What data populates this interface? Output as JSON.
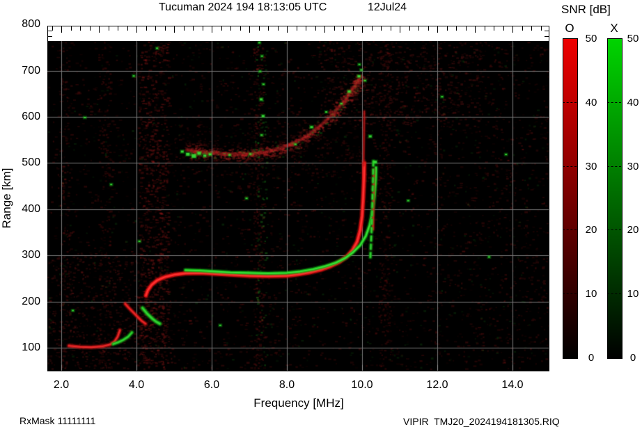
{
  "header": {
    "title": "Tucuman 2024 194 18:13:05 UTC",
    "date": "12Jul24"
  },
  "footer": {
    "rx_mask": "RxMask 11111111",
    "file": "VIPIR  TMJ20_2024194181305.RIQ"
  },
  "chart_data": {
    "type": "heatmap",
    "subtype": "ionogram",
    "title": "Tucuman 2024 194 18:13:05 UTC",
    "date_label": "12Jul24",
    "station": "Tucuman",
    "grid": true,
    "grid_color": "#787878",
    "background_color": "#000000",
    "x_axis": {
      "label": "Frequency [MHz]",
      "ticks": [
        2.0,
        4.0,
        6.0,
        8.0,
        10.0,
        12.0,
        14.0
      ],
      "tick_labels": [
        "2.0",
        "4.0",
        "6.0",
        "8.0",
        "10.0",
        "12.0",
        "14.0"
      ],
      "range": [
        1.63,
        14.96
      ],
      "minor_tick_step": 0.25
    },
    "y_axis": {
      "label": "Range [km]",
      "ticks": [
        100,
        200,
        300,
        400,
        500,
        600,
        700,
        800
      ],
      "tick_labels": [
        "100",
        "200",
        "300",
        "400",
        "500",
        "600",
        "700",
        "800"
      ],
      "range": [
        52,
        800
      ],
      "minor_tick_step": 12.5
    },
    "colorbar": {
      "title": "SNR [dB]",
      "range": [
        0,
        50
      ],
      "ticks": [
        50,
        40,
        30,
        20,
        10,
        0
      ],
      "modes": [
        {
          "label": "O",
          "color": "#ee0000"
        },
        {
          "label": "X",
          "color": "#00d400"
        }
      ]
    },
    "traces": [
      {
        "name": "E-layer O-mode",
        "mode": "O",
        "color": "#c01010",
        "core": "#f03030",
        "width": 4.5,
        "alpha": 0.8,
        "points": [
          [
            2.2,
            104
          ],
          [
            2.5,
            102
          ],
          [
            2.8,
            101
          ],
          [
            3.1,
            103
          ],
          [
            3.3,
            107
          ],
          [
            3.42,
            114
          ],
          [
            3.5,
            124
          ],
          [
            3.56,
            138
          ]
        ]
      },
      {
        "name": "E-layer X-mode",
        "mode": "X",
        "color": "#18a818",
        "core": "#35d535",
        "width": 4.5,
        "alpha": 0.85,
        "points": [
          [
            3.38,
            108
          ],
          [
            3.52,
            112
          ],
          [
            3.65,
            117
          ],
          [
            3.78,
            124
          ],
          [
            3.88,
            133
          ]
        ]
      },
      {
        "name": "F-cusp O-mode",
        "mode": "O",
        "color": "#c01010",
        "core": "#ee2828",
        "width": 4.5,
        "alpha": 0.85,
        "points": [
          [
            3.7,
            195
          ],
          [
            3.8,
            186
          ],
          [
            3.92,
            176
          ],
          [
            4.04,
            166
          ],
          [
            4.14,
            158
          ],
          [
            4.24,
            152
          ]
        ]
      },
      {
        "name": "F-cusp X-mode",
        "mode": "X",
        "color": "#18a818",
        "core": "#35d535",
        "width": 5,
        "alpha": 0.9,
        "points": [
          [
            4.16,
            186
          ],
          [
            4.28,
            174
          ],
          [
            4.42,
            163
          ],
          [
            4.53,
            156
          ],
          [
            4.62,
            152
          ]
        ]
      },
      {
        "name": "F-layer O-mode",
        "mode": "O",
        "color": "#d81010",
        "core": "#ff3030",
        "width": 5.5,
        "alpha": 0.92,
        "points": [
          [
            4.25,
            213
          ],
          [
            4.3,
            224
          ],
          [
            4.4,
            236
          ],
          [
            4.55,
            246
          ],
          [
            4.75,
            253
          ],
          [
            5.0,
            258
          ],
          [
            5.3,
            261
          ],
          [
            5.7,
            262
          ],
          [
            6.1,
            260
          ],
          [
            6.5,
            258
          ],
          [
            7.0,
            256
          ],
          [
            7.5,
            255
          ],
          [
            8.0,
            256
          ],
          [
            8.3,
            259
          ],
          [
            8.6,
            263
          ],
          [
            8.9,
            269
          ],
          [
            9.15,
            276
          ],
          [
            9.4,
            286
          ],
          [
            9.6,
            298
          ],
          [
            9.75,
            312
          ],
          [
            9.87,
            330
          ],
          [
            9.95,
            355
          ],
          [
            10.0,
            385
          ],
          [
            10.03,
            425
          ],
          [
            10.05,
            465
          ],
          [
            10.06,
            500
          ]
        ]
      },
      {
        "name": "F-layer X-mode",
        "mode": "X",
        "color": "#16b916",
        "core": "#3ae03a",
        "width": 4.2,
        "alpha": 0.9,
        "points": [
          [
            5.3,
            268
          ],
          [
            5.7,
            267
          ],
          [
            6.1,
            265
          ],
          [
            6.5,
            263
          ],
          [
            7.0,
            262
          ],
          [
            7.5,
            261
          ],
          [
            8.0,
            262
          ],
          [
            8.35,
            265
          ],
          [
            8.7,
            270
          ],
          [
            9.0,
            276
          ],
          [
            9.3,
            284
          ],
          [
            9.55,
            294
          ],
          [
            9.75,
            306
          ],
          [
            9.95,
            322
          ],
          [
            10.1,
            342
          ],
          [
            10.2,
            365
          ],
          [
            10.28,
            395
          ],
          [
            10.33,
            430
          ],
          [
            10.36,
            465
          ],
          [
            10.37,
            490
          ]
        ]
      },
      {
        "name": "O-mode asymptote fade",
        "mode": "O",
        "color": "#b80e0e",
        "core": "#d42020",
        "width": 3.2,
        "alpha": 0.5,
        "points": [
          [
            10.04,
            495
          ],
          [
            10.05,
            550
          ],
          [
            10.06,
            612
          ]
        ]
      },
      {
        "name": "second asymptote streak",
        "mode": "O",
        "color": "#c51010",
        "core": "#e62424",
        "width": 3.6,
        "alpha": 0.75,
        "points": [
          [
            10.29,
            356
          ],
          [
            10.3,
            420
          ],
          [
            10.31,
            486
          ]
        ]
      },
      {
        "name": "X-mode asymptote dashes",
        "mode": "X",
        "color": "#18a818",
        "core": "#35d535",
        "width": 4,
        "alpha": 0.85,
        "dash": [
          6,
          6
        ],
        "points": [
          [
            10.22,
            296
          ],
          [
            10.25,
            350
          ],
          [
            10.27,
            405
          ],
          [
            10.29,
            458
          ],
          [
            10.3,
            506
          ]
        ]
      }
    ],
    "diffuse_traces": [
      {
        "name": "spread-F second echo",
        "color": [
          190,
          35,
          35
        ],
        "spread": 11,
        "count": 950,
        "green_fraction": 0.08,
        "points": [
          [
            5.35,
            528
          ],
          [
            5.7,
            524
          ],
          [
            6.1,
            521
          ],
          [
            6.5,
            519
          ],
          [
            6.9,
            519
          ],
          [
            7.2,
            521
          ],
          [
            7.55,
            526
          ],
          [
            7.9,
            534
          ],
          [
            8.25,
            545
          ],
          [
            8.6,
            562
          ],
          [
            8.95,
            585
          ],
          [
            9.25,
            608
          ],
          [
            9.5,
            632
          ],
          [
            9.7,
            655
          ],
          [
            9.85,
            672
          ],
          [
            9.95,
            685
          ]
        ]
      }
    ],
    "green_specks": [
      [
        5.18,
        527,
        4
      ],
      [
        5.32,
        522,
        5
      ],
      [
        5.47,
        519,
        6
      ],
      [
        5.62,
        524,
        5
      ],
      [
        5.78,
        518,
        4
      ],
      [
        5.92,
        521,
        4
      ],
      [
        6.45,
        519,
        3
      ],
      [
        7.0,
        521,
        3
      ],
      [
        7.28,
        640,
        4
      ],
      [
        7.33,
        604,
        4
      ],
      [
        7.3,
        562,
        3
      ],
      [
        7.26,
        700,
        3
      ],
      [
        7.31,
        733,
        3
      ],
      [
        7.24,
        762,
        3
      ],
      [
        7.35,
        672,
        3
      ],
      [
        8.2,
        542,
        3
      ],
      [
        8.62,
        580,
        4
      ],
      [
        9.02,
        612,
        3
      ],
      [
        9.42,
        630,
        3
      ],
      [
        9.62,
        657,
        4
      ],
      [
        9.88,
        690,
        4
      ],
      [
        9.95,
        703,
        3
      ],
      [
        10.18,
        560,
        4
      ],
      [
        10.3,
        505,
        5
      ],
      [
        9.9,
        715,
        3
      ],
      [
        10.05,
        680,
        3
      ],
      [
        4.52,
        750,
        3
      ],
      [
        6.9,
        425,
        3
      ],
      [
        2.28,
        182,
        3
      ],
      [
        4.05,
        332,
        3
      ],
      [
        12.1,
        645,
        3
      ],
      [
        13.35,
        298,
        3
      ],
      [
        3.3,
        455,
        3
      ],
      [
        6.2,
        150,
        3
      ],
      [
        11.2,
        420,
        3
      ],
      [
        13.8,
        520,
        3
      ],
      [
        2.6,
        600,
        3
      ],
      [
        3.9,
        690,
        3
      ]
    ],
    "noise_regions": [
      {
        "f": [
          1.63,
          14.96
        ],
        "r": [
          55,
          790
        ],
        "count": 3000,
        "color": [
          148,
          24,
          24
        ],
        "alpha": [
          0.05,
          0.28
        ],
        "size": [
          2,
          5
        ]
      },
      {
        "f": [
          1.63,
          14.96
        ],
        "r": [
          55,
          790
        ],
        "count": 550,
        "color": [
          28,
          135,
          28
        ],
        "alpha": [
          0.05,
          0.22
        ],
        "size": [
          2,
          4
        ]
      },
      {
        "f": [
          4.05,
          4.85
        ],
        "r": [
          55,
          780
        ],
        "count": 800,
        "color": [
          158,
          26,
          26
        ],
        "alpha": [
          0.08,
          0.38
        ],
        "size": [
          2,
          5
        ]
      },
      {
        "f": [
          7.1,
          7.38
        ],
        "r": [
          55,
          780
        ],
        "count": 280,
        "color": [
          150,
          25,
          25
        ],
        "alpha": [
          0.08,
          0.32
        ],
        "size": [
          2,
          4
        ]
      },
      {
        "f": [
          2.98,
          3.3
        ],
        "r": [
          55,
          780
        ],
        "count": 200,
        "color": [
          140,
          20,
          20
        ],
        "alpha": [
          0.07,
          0.28
        ],
        "size": [
          2,
          4
        ]
      },
      {
        "f": [
          10.42,
          10.78
        ],
        "r": [
          55,
          780
        ],
        "count": 240,
        "color": [
          140,
          20,
          20
        ],
        "alpha": [
          0.07,
          0.3
        ],
        "size": [
          2,
          4
        ]
      },
      {
        "f": [
          1.95,
          2.2
        ],
        "r": [
          55,
          780
        ],
        "count": 150,
        "color": [
          150,
          25,
          25
        ],
        "alpha": [
          0.08,
          0.28
        ],
        "size": [
          2,
          4
        ]
      },
      {
        "f": [
          8.8,
          13.2
        ],
        "r": [
          580,
          770
        ],
        "count": 560,
        "color": [
          150,
          30,
          30
        ],
        "alpha": [
          0.07,
          0.32
        ],
        "size": [
          2,
          5
        ]
      },
      {
        "f": [
          1.63,
          5.0
        ],
        "r": [
          55,
          310
        ],
        "count": 550,
        "color": [
          150,
          30,
          30
        ],
        "alpha": [
          0.07,
          0.3
        ],
        "size": [
          2,
          4
        ]
      },
      {
        "f": [
          5.0,
          10.0
        ],
        "r": [
          470,
          585
        ],
        "count": 260,
        "color": [
          150,
          28,
          28
        ],
        "alpha": [
          0.05,
          0.22
        ],
        "size": [
          2,
          4
        ]
      },
      {
        "f": [
          13.0,
          14.96
        ],
        "r": [
          55,
          780
        ],
        "count": 260,
        "color": [
          145,
          24,
          24
        ],
        "alpha": [
          0.06,
          0.26
        ],
        "size": [
          2,
          4
        ]
      },
      {
        "f": [
          7.15,
          7.45
        ],
        "r": [
          55,
          780
        ],
        "count": 90,
        "color": [
          30,
          150,
          30
        ],
        "alpha": [
          0.1,
          0.45
        ],
        "size": [
          2,
          4
        ]
      },
      {
        "f": [
          11.9,
          12.1
        ],
        "r": [
          55,
          780
        ],
        "count": 90,
        "color": [
          135,
          20,
          20
        ],
        "alpha": [
          0.06,
          0.24
        ],
        "size": [
          2,
          4
        ]
      }
    ]
  }
}
